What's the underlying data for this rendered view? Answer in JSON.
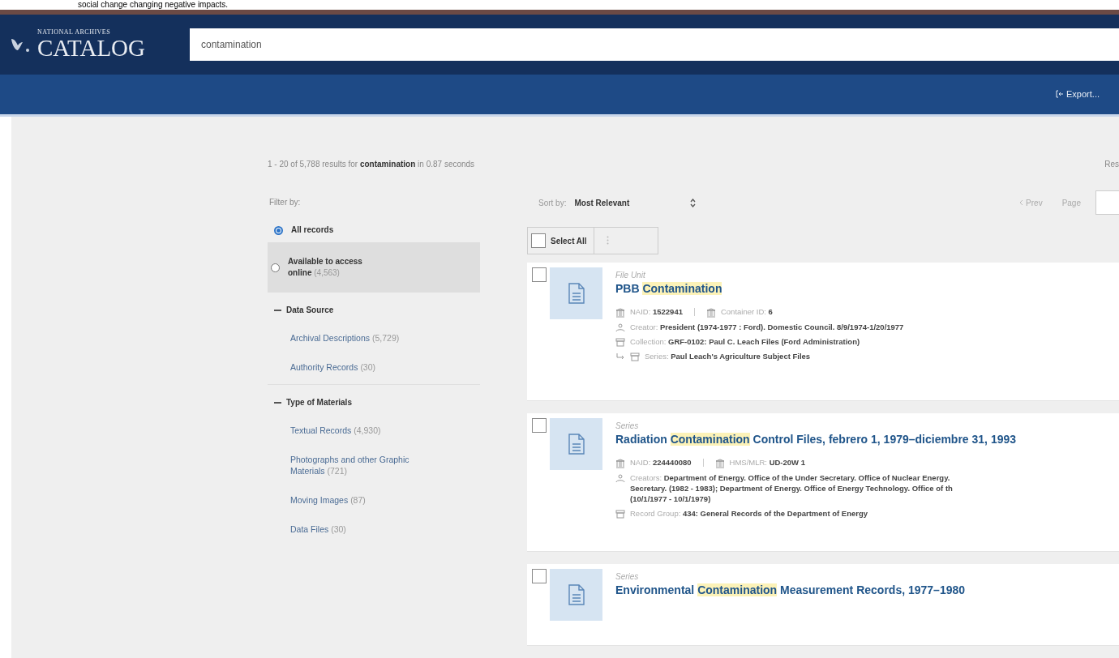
{
  "caption": "social change changing negative impacts.",
  "header": {
    "logo_small": "NATIONAL ARCHIVES",
    "logo_big": "CATALOG",
    "search": {
      "value": "contamination"
    }
  },
  "toolbar": {
    "export": "Export..."
  },
  "summary": "1 - 20 of 5,788 results for **contamination** in 0.87 seconds",
  "summary_right": "Res",
  "filter": {
    "title": "Filter by:",
    "radios": [
      {
        "label": "All records",
        "selected": true
      },
      {
        "label": "Available to access online",
        "count": "(4,563)",
        "selected": false
      }
    ],
    "sections": [
      {
        "title": "Data Source",
        "expanded": true,
        "items": [
          {
            "label": "Archival Descriptions",
            "count": "(5,729)"
          },
          {
            "label": "Authority Records",
            "count": "(30)"
          }
        ]
      },
      {
        "title": "Type of Materials",
        "expanded": true,
        "items": [
          {
            "label": "Textual Records",
            "count": "(4,930)"
          },
          {
            "label": "Photographs and other Graphic Materials",
            "count": "(721)"
          },
          {
            "label": "Moving Images",
            "count": "(87)"
          },
          {
            "label": "Data Files",
            "count": "(30)"
          }
        ]
      }
    ]
  },
  "sort": {
    "label": "Sort by:",
    "value": "Most Relevant"
  },
  "pager": {
    "prev": "Prev",
    "page": "Page"
  },
  "select_all": {
    "label": "Select All",
    "checked": false
  },
  "results": [
    {
      "type": "File Unit",
      "checked": false,
      "title": [
        {
          "text": "PBB ",
          "highlighted": false
        },
        {
          "text": "Contamination",
          "highlighted": true
        }
      ],
      "lines": [
        {
          "kind": "ids",
          "parts": [
            {
              "label": "NAID: ",
              "value": "1522941"
            },
            {
              "label": "Container ID: ",
              "value": "6"
            }
          ]
        },
        {
          "kind": "creator",
          "label": "Creator: ",
          "value": [
            "President (1974-1977 : Ford). Domestic Council. 8/9/1974-1/20/1977"
          ]
        },
        {
          "kind": "collection",
          "label": "Collection: ",
          "value": [
            "GRF-0102: Paul C. Leach Files (Ford Administration)"
          ]
        },
        {
          "kind": "series",
          "label": "Series: ",
          "value": [
            "Paul Leach's Agriculture Subject Files"
          ]
        }
      ]
    },
    {
      "type": "Series",
      "checked": false,
      "title": [
        {
          "text": "Radiation ",
          "highlighted": false
        },
        {
          "text": "Contamination",
          "highlighted": true
        },
        {
          "text": " Control Files, febrero 1, 1979–diciembre 31, 1993",
          "highlighted": false
        }
      ],
      "lines": [
        {
          "kind": "ids",
          "parts": [
            {
              "label": "NAID: ",
              "value": "224440080"
            },
            {
              "label": "HMS/MLR: ",
              "value": "UD-20W 1"
            }
          ]
        },
        {
          "kind": "creator",
          "label": "Creators: ",
          "value": [
            "Department of Energy. Office of the Under Secretary. Office of Nuclear Energy.",
            "Secretary. (1982 - 1983); Department of Energy. Office of Energy Technology. Office of th",
            "(10/1/1977 - 10/1/1979)"
          ]
        },
        {
          "kind": "record_group",
          "label": "Record Group: ",
          "value": [
            "434: General Records of the Department of Energy"
          ]
        }
      ]
    },
    {
      "type": "Series",
      "checked": false,
      "title": [
        {
          "text": "Environmental ",
          "highlighted": false
        },
        {
          "text": "Contamination",
          "highlighted": true
        },
        {
          "text": " Measurement Records, 1977–1980",
          "highlighted": false
        }
      ]
    }
  ]
}
